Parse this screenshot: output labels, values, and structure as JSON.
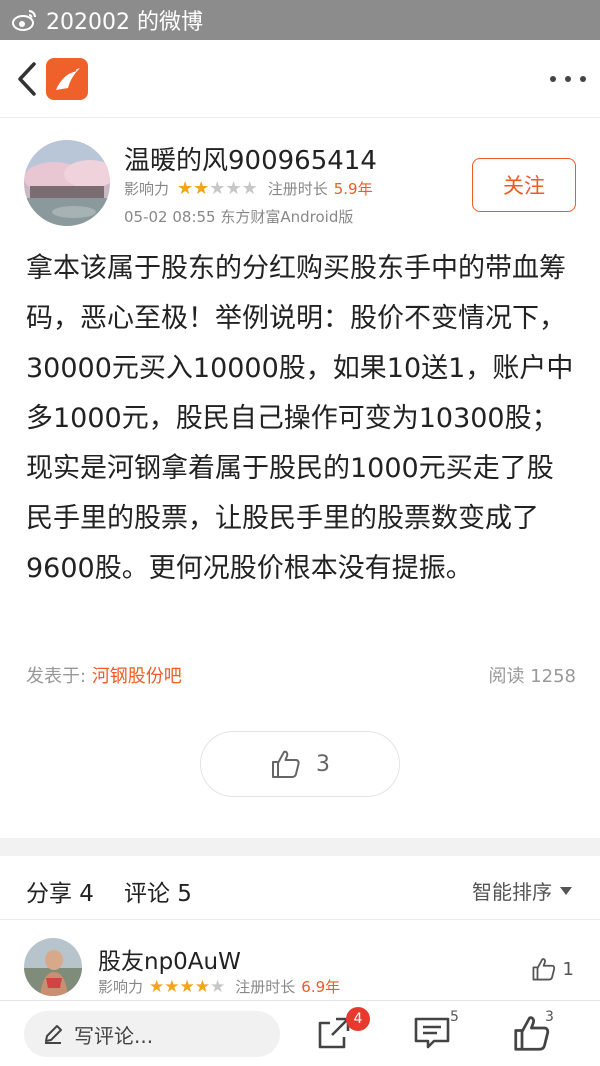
{
  "status_bar": {
    "title": "202002 的微博"
  },
  "nav": {
    "back_icon": "chevron-left-icon",
    "logo_icon": "app-logo-icon",
    "more_icon": "more-dots-icon"
  },
  "post": {
    "author": "温暖的风900965414",
    "influence_label": "影响力",
    "influence_stars": 2,
    "influence_max": 5,
    "reg_label": "注册时长",
    "reg_value": "5.9年",
    "time_source": "05-02 08:55 东方财富Android版",
    "follow_label": "关注",
    "content": "拿本该属于股东的分红购买股东手中的带血筹码，恶心至极！举例说明：股价不变情况下，30000元买入10000股，如果10送1，账户中多1000元，股民自己操作可变为10300股；现实是河钢拿着属于股民的1000元买走了股民手里的股票，让股民手里的股票数变成了9600股。更何况股价根本没有提振。",
    "posted_in_label": "发表于:",
    "posted_in_bar": "河钢股份吧",
    "reads_label": "阅读",
    "reads_count": "1258",
    "like_count": "3"
  },
  "tabs": {
    "share": "分享 4",
    "comment": "评论 5",
    "sort": "智能排序"
  },
  "comment": {
    "name": "股友np0AuW",
    "influence_label": "影响力",
    "influence_stars": 4,
    "influence_max": 5,
    "reg_label": "注册时长",
    "reg_value": "6.9年",
    "like_count": "1"
  },
  "bottom": {
    "compose_placeholder": "写评论...",
    "share_badge": "4",
    "comment_count": "5",
    "like_count": "3"
  },
  "colors": {
    "accent": "#f05a24",
    "star": "#f0a51c",
    "badge": "#e8392e"
  }
}
